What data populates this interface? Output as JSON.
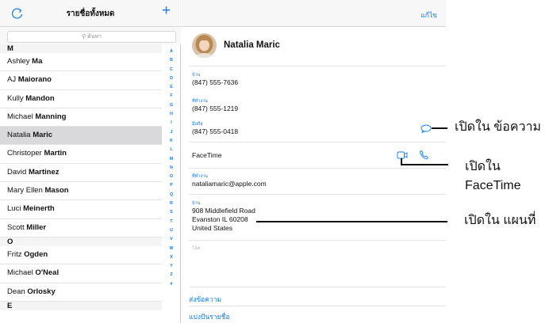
{
  "list": {
    "title": "รายชื่อทั้งหมด",
    "search_placeholder": "ค้นหา",
    "sections": [
      {
        "letter": "M",
        "rows": [
          {
            "first": "Ashley",
            "last": "Ma"
          },
          {
            "first": "AJ",
            "last": "Maiorano"
          },
          {
            "first": "Kully",
            "last": "Mandon"
          },
          {
            "first": "Michael",
            "last": "Manning"
          },
          {
            "first": "Natalia",
            "last": "Maric",
            "selected": true
          },
          {
            "first": "Christoper",
            "last": "Martin"
          },
          {
            "first": "David",
            "last": "Martinez"
          },
          {
            "first": "Mary Ellen",
            "last": "Mason"
          },
          {
            "first": "Luci",
            "last": "Meinerth"
          },
          {
            "first": "Scott",
            "last": "Miller"
          }
        ]
      },
      {
        "letter": "O",
        "rows": [
          {
            "first": "Fritz",
            "last": "Ogden"
          },
          {
            "first": "Michael",
            "last": "O'Neal"
          },
          {
            "first": "Dean",
            "last": "Orlosky"
          }
        ]
      },
      {
        "letter": "E",
        "rows": []
      }
    ],
    "index": [
      "A",
      "B",
      "C",
      "D",
      "E",
      "F",
      "G",
      "H",
      "I",
      "J",
      "K",
      "L",
      "M",
      "N",
      "O",
      "P",
      "Q",
      "R",
      "S",
      "T",
      "U",
      "V",
      "W",
      "X",
      "Y",
      "Z",
      "#"
    ]
  },
  "detail": {
    "edit_label": "แก้ไข",
    "name": "Natalia Maric",
    "home_label": "บ้าน",
    "home_phone": "(847) 555-7636",
    "work_label": "ที่ทำงาน",
    "work_phone": "(847) 555-1219",
    "mobile_label": "มือถือ",
    "mobile_phone": "(847) 555-0418",
    "facetime_label": "FaceTime",
    "email_label": "ที่ทำงาน",
    "email": "nataliamaric@apple.com",
    "address_label": "บ้าน",
    "address_line1": "908 Middlefield Road",
    "address_line2": "Evanston IL 60208",
    "address_line3": "United States",
    "notes_placeholder": "โน้ต",
    "send_message": "ส่งข้อความ",
    "share_contact": "แบ่งปันรายชื่อ"
  },
  "callouts": {
    "message": "เปิดใน ข้อความ",
    "facetime_line1": "เปิดใน",
    "facetime_line2": "FaceTime",
    "maps": "เปิดใน แผนที่"
  },
  "colors": {
    "accent": "#0a7aff",
    "selected_row": "#d9d9dc"
  }
}
